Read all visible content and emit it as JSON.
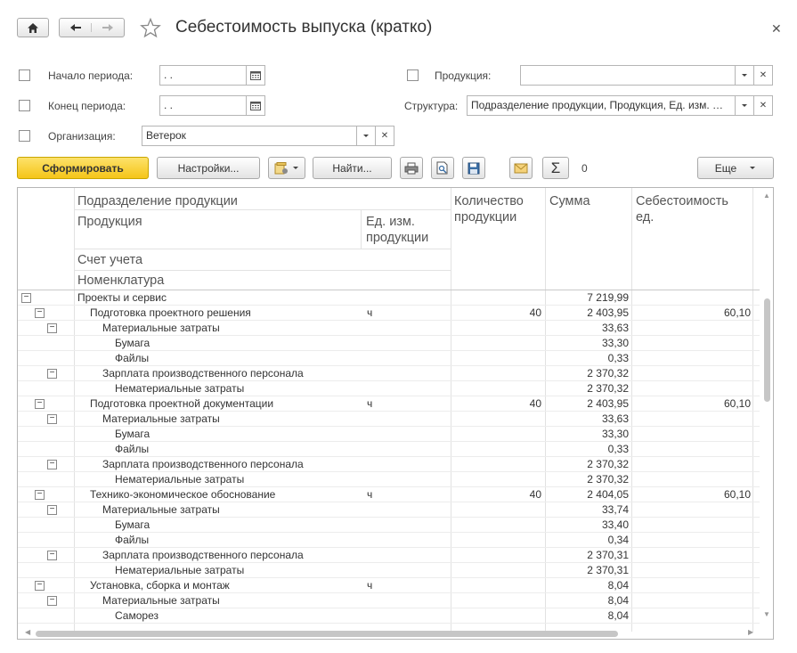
{
  "window": {
    "title": "Себестоимость выпуска (кратко)"
  },
  "form": {
    "period_start_label": "Начало периода:",
    "period_start_value": " .  .",
    "period_end_label": "Конец периода:",
    "period_end_value": " .  .",
    "organization_label": "Организация:",
    "organization_value": "Ветерок",
    "product_label": "Продукция:",
    "product_value": "",
    "structure_label": "Структура:",
    "structure_value": "Подразделение продукции, Продукция, Ед. изм. …"
  },
  "toolbar": {
    "generate": "Сформировать",
    "settings": "Настройки...",
    "find": "Найти...",
    "sum_value": "0",
    "more": "Еще"
  },
  "report": {
    "headers": {
      "division": "Подразделение продукции",
      "product": "Продукция",
      "unit": "Ед. изм. продукции",
      "account": "Счет учета",
      "nomenclature": "Номенклатура",
      "quantity": "Количество продукции",
      "sum": "Сумма",
      "unit_cost": "Себестоимость ед."
    },
    "rows": [
      {
        "level": 0,
        "name": "Проекты и сервис",
        "unit": "",
        "qty": "",
        "sum": "7 219,99",
        "cost": ""
      },
      {
        "level": 1,
        "name": "Подготовка проектного решения",
        "unit": "ч",
        "qty": "40",
        "sum": "2 403,95",
        "cost": "60,10"
      },
      {
        "level": 2,
        "name": "Материальные затраты",
        "unit": "",
        "qty": "",
        "sum": "33,63",
        "cost": ""
      },
      {
        "level": 3,
        "name": "Бумага",
        "unit": "",
        "qty": "",
        "sum": "33,30",
        "cost": ""
      },
      {
        "level": 3,
        "name": "Файлы",
        "unit": "",
        "qty": "",
        "sum": "0,33",
        "cost": ""
      },
      {
        "level": 2,
        "name": "Зарплата производственного персонала",
        "unit": "",
        "qty": "",
        "sum": "2 370,32",
        "cost": ""
      },
      {
        "level": 3,
        "name": "Нематериальные затраты",
        "unit": "",
        "qty": "",
        "sum": "2 370,32",
        "cost": ""
      },
      {
        "level": 1,
        "name": "Подготовка проектной документации",
        "unit": "ч",
        "qty": "40",
        "sum": "2 403,95",
        "cost": "60,10"
      },
      {
        "level": 2,
        "name": "Материальные затраты",
        "unit": "",
        "qty": "",
        "sum": "33,63",
        "cost": ""
      },
      {
        "level": 3,
        "name": "Бумага",
        "unit": "",
        "qty": "",
        "sum": "33,30",
        "cost": ""
      },
      {
        "level": 3,
        "name": "Файлы",
        "unit": "",
        "qty": "",
        "sum": "0,33",
        "cost": ""
      },
      {
        "level": 2,
        "name": "Зарплата производственного персонала",
        "unit": "",
        "qty": "",
        "sum": "2 370,32",
        "cost": ""
      },
      {
        "level": 3,
        "name": "Нематериальные затраты",
        "unit": "",
        "qty": "",
        "sum": "2 370,32",
        "cost": ""
      },
      {
        "level": 1,
        "name": "Технико-экономическое обоснование",
        "unit": "ч",
        "qty": "40",
        "sum": "2 404,05",
        "cost": "60,10"
      },
      {
        "level": 2,
        "name": "Материальные затраты",
        "unit": "",
        "qty": "",
        "sum": "33,74",
        "cost": ""
      },
      {
        "level": 3,
        "name": "Бумага",
        "unit": "",
        "qty": "",
        "sum": "33,40",
        "cost": ""
      },
      {
        "level": 3,
        "name": "Файлы",
        "unit": "",
        "qty": "",
        "sum": "0,34",
        "cost": ""
      },
      {
        "level": 2,
        "name": "Зарплата производственного персонала",
        "unit": "",
        "qty": "",
        "sum": "2 370,31",
        "cost": ""
      },
      {
        "level": 3,
        "name": "Нематериальные затраты",
        "unit": "",
        "qty": "",
        "sum": "2 370,31",
        "cost": ""
      },
      {
        "level": 1,
        "name": "Установка, сборка и монтаж",
        "unit": "ч",
        "qty": "",
        "sum": "8,04",
        "cost": ""
      },
      {
        "level": 2,
        "name": "Материальные затраты",
        "unit": "",
        "qty": "",
        "sum": "8,04",
        "cost": ""
      },
      {
        "level": 3,
        "name": "Саморез",
        "unit": "",
        "qty": "",
        "sum": "8,04",
        "cost": ""
      }
    ]
  },
  "colors": {
    "primary_button": "#f5c518",
    "border": "#b5b5b5"
  }
}
